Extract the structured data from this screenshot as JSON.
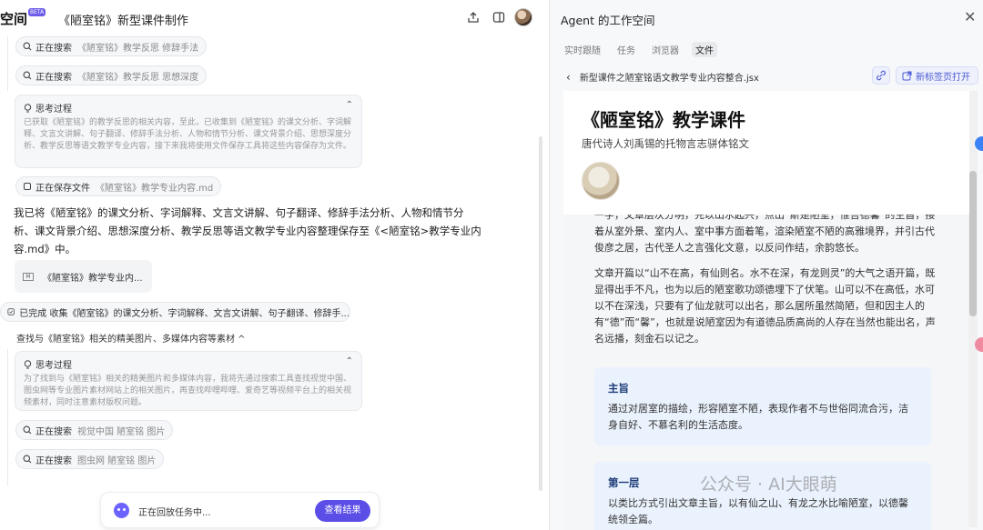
{
  "left": {
    "brand": "空间",
    "beta": "BETA",
    "title": "《陋室铭》新型课件制作",
    "chips": [
      {
        "label": "正在搜索",
        "detail": "《陋室铭》教学反思 修辞手法"
      },
      {
        "label": "正在搜索",
        "detail": "《陋室铭》教学反思 思想深度"
      }
    ],
    "think1": {
      "title": "思考过程",
      "body": "已获取《陋室铭》的教学反思的相关内容，至此，已收集到《陋室铭》的课文分析、字词解释、文言文讲解、句子翻译、修辞手法分析、人物和情节分析、课文背景介绍、思想深度分析、教学反思等语文教学专业内容，接下来我将使用文件保存工具将这些内容保存为文件。"
    },
    "save_chip": {
      "label": "正在保存文件",
      "detail": "《陋室铭》教学专业内容.md"
    },
    "message": "我已将《陋室铭》的课文分析、字词解释、文言文讲解、句子翻译、修辞手法分析、人物和情节分析、课文背景介绍、思想深度分析、教学反思等语文教学专业内容整理保存至《<陋室铭>教学专业内容.md》中。",
    "file_card": "《陋室铭》教学专业内...",
    "done": "已完成 收集《陋室铭》的课文分析、字词解释、文言文讲解、句子翻译、修辞手...",
    "section": "查找与《陋室铭》相关的精美图片、多媒体内容等素材 ^",
    "think2": {
      "title": "思考过程",
      "body": "为了找到与《陋室铭》相关的精美图片和多媒体内容，我将先通过搜索工具查找视觉中国、图虫网等专业图片素材网站上的相关图片，再查找哔哩哔哩、爱奇艺等视频平台上的相关视频素材，同时注意素材版权问题。"
    },
    "chips2": [
      {
        "label": "正在搜索",
        "detail": "视觉中国 陋室铭 图片"
      },
      {
        "label": "正在搜索",
        "detail": "图虫网 陋室铭 图片"
      }
    ],
    "replay": {
      "text": "正在回放任务中...",
      "button": "查看结果"
    }
  },
  "right": {
    "title": "Agent 的工作空间",
    "tabs": [
      "实时跟随",
      "任务",
      "浏览器",
      "文件"
    ],
    "active_tab": "文件",
    "file_path": "新型课件之陋室铭语文教学专业内容整合.jsx",
    "new_tab": "新标签页打开",
    "doc": {
      "h1": "《陋室铭》教学课件",
      "subtitle": "唐代诗人刘禹锡的托物言志骈体铭文",
      "para1": "一学，文章层次分明，先以山水起兴，点出“斯是陋室，惟吾德馨”的主旨，接着从室外景、室内人、室中事方面着笔，渲染陋室不陋的高雅境界，并引古代俊彦之居，古代圣人之言强化文意，以反问作结，余韵悠长。",
      "para2": "文章开篇以“山不在高，有仙则名。水不在深，有龙则灵”的大气之语开篇，既显得出手不凡，也为以后的陋室歌功颂德埋下了伏笔。山可以不在高低，水可以不在深浅，只要有了仙龙就可以出名，那么居所虽然简陋，但和因主人的有“德”而“馨”，也就是说陋室因为有道德品质高尚的人存在当然也能出名，声名远播，刻金石以记之。",
      "card1": {
        "heading": "主旨",
        "body": "通过对居室的描绘，形容陋室不陋，表现作者不与世俗同流合污，洁身自好、不慕名利的生活态度。"
      },
      "card2": {
        "heading": "第一层",
        "body": "以类比方式引出文章主旨，以有仙之山、有龙之水比喻陋室，以德馨统领全篇。"
      }
    },
    "watermark": "公众号 · AI大眼萌"
  },
  "colors": {
    "accent": "#5b4ee6",
    "card_bg": "#eaf2fd",
    "card_heading": "#1d3c78"
  }
}
